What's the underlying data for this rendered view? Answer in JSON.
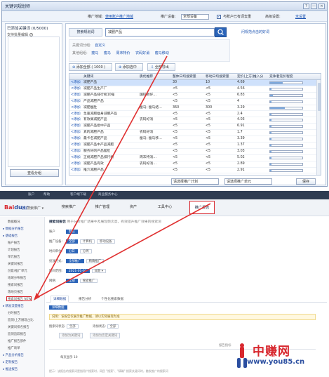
{
  "window": {
    "title": "关键词规划师",
    "buttons": [
      "?",
      "—",
      "×"
    ]
  },
  "toolbar": {
    "promo_region_label": "推广地域:",
    "promo_region_link": "使用账户推广地域",
    "promo_device_label": "推广设备:",
    "promo_device_value": "全部设备",
    "checkbox_label": "与账户已有词去重",
    "advanced_label": "高级设置:",
    "advanced_value": "未设置"
  },
  "left_panel": {
    "title": "已添加关键词 (0/5000)",
    "subtitle": "支持批量编辑",
    "help_icon": "question-icon",
    "view_button": "查看分组"
  },
  "search": {
    "tab_label": "搜索规划词",
    "query": "减肥产品",
    "button_icon": "search-icon",
    "hint_link": "问规范点击的好词"
  },
  "keyword_suggest": {
    "row1_label": "关键词分组:",
    "row1_items": [
      "自定义"
    ],
    "row2_label": "其他组组:",
    "row2_items": [
      "瘦马",
      "瘦马",
      "周末特价",
      "农码好消",
      "瘦马移动"
    ]
  },
  "actions": {
    "add_all": "添加全部 ( 1000 )",
    "add_selected": "添加选中",
    "export_all": "全部导出"
  },
  "grid": {
    "columns": [
      "",
      "关键词",
      "质优推荐",
      "整体日均搜索量",
      "移动日均搜索量",
      "定价(上方)推入分",
      "竞争者竞价程度"
    ],
    "add_label": "<添加",
    "rows": [
      {
        "kw": "减肥产品",
        "rec": "",
        "total": "30",
        "mobile": "10",
        "bid": "4.69",
        "comp": 0.4,
        "selected": true
      },
      {
        "kw": "减肥产品生产厂",
        "rec": "",
        "total": "<5",
        "mobile": "<5",
        "bid": "4.56",
        "comp": 0.05,
        "selected": false
      },
      {
        "kw": "减肥产品排行榜10强",
        "rec": "国码新好…",
        "total": "<5",
        "mobile": "<5",
        "bid": "6.83",
        "comp": 0.08,
        "selected": false
      },
      {
        "kw": "产品减肥产品",
        "rec": "",
        "total": "<5",
        "mobile": "<5",
        "bid": "4",
        "comp": 0.05,
        "selected": false
      },
      {
        "kw": "减肥瘦肚",
        "rec": "瘦马; 瘦马结…",
        "total": "360",
        "mobile": "300",
        "bid": "3.29",
        "comp": 0.45,
        "selected": false
      },
      {
        "kw": "急速减肥瘦身减肥产品",
        "rec": "",
        "total": "<5",
        "mobile": "<5",
        "bid": "2.4",
        "comp": 0.04,
        "selected": false
      },
      {
        "kw": "有效果减肥产品",
        "rec": "农码好消",
        "total": "<5",
        "mobile": "<5",
        "bid": "4.03",
        "comp": 0.05,
        "selected": false
      },
      {
        "kw": "减肥产品批中产品",
        "rec": "",
        "total": "<5",
        "mobile": "<5",
        "bid": "6.91",
        "comp": 0.05,
        "selected": false
      },
      {
        "kw": "真的减肥产品",
        "rec": "农码好消",
        "total": "<5",
        "mobile": "<5",
        "bid": "1.7",
        "comp": 0.05,
        "selected": false
      },
      {
        "kw": "最卡名减肥产品",
        "rec": "瘦马; 瘦马移…",
        "total": "<5",
        "mobile": "<5",
        "bid": "3.39",
        "comp": 0.05,
        "selected": false
      },
      {
        "kw": "减肥产品中产品减肥",
        "rec": "",
        "total": "<5",
        "mobile": "<5",
        "bid": "1.37",
        "comp": 0.05,
        "selected": false
      },
      {
        "kw": "服务好的产品瘦肚",
        "rec": "",
        "total": "<5",
        "mobile": "<5",
        "bid": "3.03",
        "comp": 0.05,
        "selected": false
      },
      {
        "kw": "正规减肥产品排行榜",
        "rec": "周末特消…",
        "total": "<5",
        "mobile": "<5",
        "bid": "5.02",
        "comp": 0.05,
        "selected": false
      },
      {
        "kw": "减肥产品有效",
        "rec": "农码好消…",
        "total": "<5",
        "mobile": "<5",
        "bid": "2.89",
        "comp": 0.05,
        "selected": false
      },
      {
        "kw": "推介减肥产品",
        "rec": "",
        "total": "<5",
        "mobile": "<5",
        "bid": "2.91",
        "comp": 0.05,
        "selected": false
      }
    ]
  },
  "bottom": {
    "plan_select": "请选择推广计划",
    "unit_select": "请选择推广单元",
    "save_button": "保存"
  },
  "web": {
    "topbar_items": [
      "账户",
      "帮助",
      "客户端下载",
      "商业服务中心"
    ],
    "logo_main": "Bai",
    "logo_accent": "du",
    "logo_suffix": "推广",
    "logo_product": "搜索推广 ▾",
    "nav_tabs": [
      "搜索推广",
      "推广管理",
      "资产",
      "工具中心",
      "推广报告"
    ],
    "active_tab": "推广报告",
    "sidebar": [
      {
        "label": "数据概况",
        "group": false
      },
      {
        "label": "数据分析报告",
        "group": true
      },
      {
        "label": "基础报告",
        "group": true
      },
      {
        "label": "账户报告",
        "group": false
      },
      {
        "label": "计划报告",
        "group": false
      },
      {
        "label": "单元报告",
        "group": false
      },
      {
        "label": "关键词报告",
        "group": false
      },
      {
        "label": "创意/推广单元",
        "group": false
      },
      {
        "label": "地域分布报告",
        "group": false
      },
      {
        "label": "搜索词报告",
        "group": false
      },
      {
        "label": "落地页报告",
        "group": false
      },
      {
        "label": "搜索词报告 NEW",
        "group": false
      },
      {
        "label": "精准流量报告",
        "group": true
      },
      {
        "label": "分时报告",
        "group": false
      },
      {
        "label": "监测/上方展现占比",
        "group": false
      },
      {
        "label": "关键词排名报告",
        "group": false
      },
      {
        "label": "监测追踪报告",
        "group": false
      },
      {
        "label": "推广报告部件",
        "group": false
      },
      {
        "label": "推广询单",
        "group": false
      },
      {
        "label": "产品分析报告",
        "group": true
      },
      {
        "label": "定制报告",
        "group": true
      },
      {
        "label": "推送报告",
        "group": true
      }
    ],
    "page_title": "搜索词报告",
    "page_desc": "用于分析推广结果中及展现频次高，有效提升推广效果的搜索词",
    "filters": [
      {
        "label": "账户",
        "chips": [
          "默认"
        ]
      },
      {
        "label": "推广设备:",
        "chips": [
          "全部",
          "计算机",
          "移动设备"
        ]
      },
      {
        "label": "时间单位:",
        "chips": [
          "分日",
          "分周"
        ]
      },
      {
        "label": "投放方式:",
        "chips": [
          "全部推广",
          "精确推广"
        ]
      },
      {
        "label": "时间范围:",
        "chips": [
          "2021-01-01",
          "日期 ▾"
        ]
      },
      {
        "label": "网络:",
        "chips": [
          "全部",
          "搜索推广"
        ]
      }
    ],
    "tabs": [
      "详细数据",
      "报告分析",
      "个性化搜索数据"
    ],
    "notice": "说明：该报告仅展示推广数据，请以实际展现为准",
    "filter2_label": "搜索词状态:",
    "filter2_value": "全部",
    "filter3_label": "添加状态:",
    "filter3_value": "全部",
    "btn_add": "添加为关键词",
    "btn_neg": "添加为否定关键词",
    "col_header": "报告指标",
    "pager": "每页显示 10",
    "footnote": "提示：该报告的搜索词是指用户搜索时，网民 \"搜索\"、\"精确\" 搜索关键词时，触发推广的搜索词"
  },
  "watermark": {
    "brand": "中赚网",
    "url": "www.you85.cn"
  }
}
